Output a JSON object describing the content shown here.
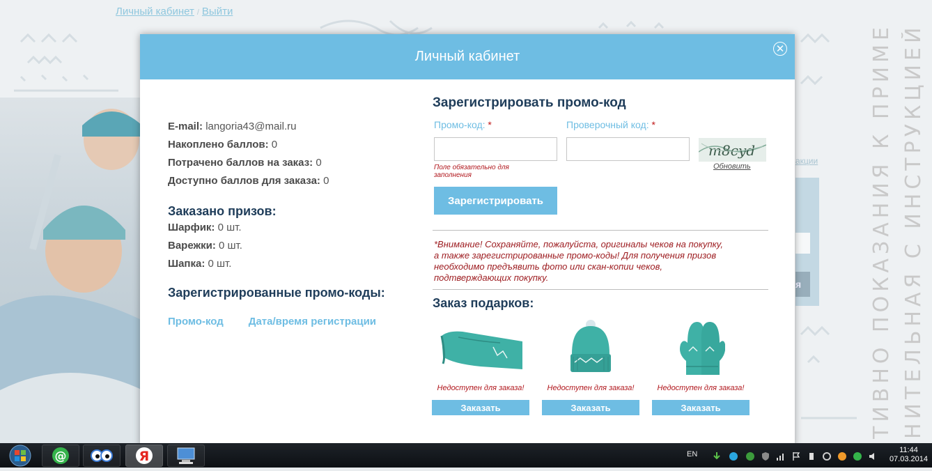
{
  "background": {
    "top_links": {
      "cabinet": "Личный кабинет",
      "logout": "Выйти",
      "separator": "/"
    },
    "side_link": "акции",
    "side_button": "я",
    "vertical_text_1": "ТИВНО ПОКАЗАНИЯ К ПРИМЕНЕНИЮ",
    "vertical_text_2": "НИТЕЛЬНАЯ С ИНСТРУКЦИЕЙ ПО ПРИМЕНЕНИЮ"
  },
  "modal": {
    "title": "Личный кабинет",
    "account": {
      "email_label": "E-mail:",
      "email_value": "langoria43@mail.ru",
      "accumulated_label": "Накоплено баллов:",
      "accumulated_value": "0",
      "spent_label": "Потрачено баллов на заказ:",
      "spent_value": "0",
      "available_label": "Доступно баллов для заказа:",
      "available_value": "0"
    },
    "ordered": {
      "title": "Заказано призов:",
      "items": [
        {
          "label": "Шарфик:",
          "value": "0 шт."
        },
        {
          "label": "Варежки:",
          "value": "0 шт."
        },
        {
          "label": "Шапка:",
          "value": "0 шт."
        }
      ]
    },
    "registered_codes": {
      "title": "Зарегистрированные промо-коды:",
      "col_code": "Промо-код",
      "col_datetime": "Дата/время регистрации"
    },
    "register": {
      "title": "Зарегистрировать промо-код",
      "promo_label": "Промо-код:",
      "captcha_label": "Проверочный код:",
      "required_mark": "*",
      "promo_value": "",
      "captcha_value": "",
      "error_text": "Поле обязательно для заполнения",
      "captcha_text": "m8cyd",
      "refresh_label": "Обновить",
      "submit_label": "Зарегистрировать"
    },
    "notice": {
      "line1": "*Внимание! Сохраняйте, пожалуйста, оригиналы чеков на покупку,",
      "line2": "а также зарегистрированные промо-коды! Для получения призов",
      "line3": "необходимо предъявить фото или скан-копии чеков,",
      "line4": "подтверждающих покупку."
    },
    "gifts": {
      "title": "Заказ подарков:",
      "items": [
        {
          "name": "scarf",
          "status": "Недоступен для заказа!",
          "button": "Заказать"
        },
        {
          "name": "hat",
          "status": "Недоступен для заказа!",
          "button": "Заказать"
        },
        {
          "name": "mittens",
          "status": "Недоступен для заказа!",
          "button": "Заказать"
        }
      ],
      "color": "#3fb1a6"
    },
    "colors": {
      "header": "#6ebde3",
      "title": "#1f3d5a",
      "error": "#b0161c"
    }
  },
  "taskbar": {
    "lang": "EN",
    "time": "11:44",
    "date": "07.03.2014"
  }
}
